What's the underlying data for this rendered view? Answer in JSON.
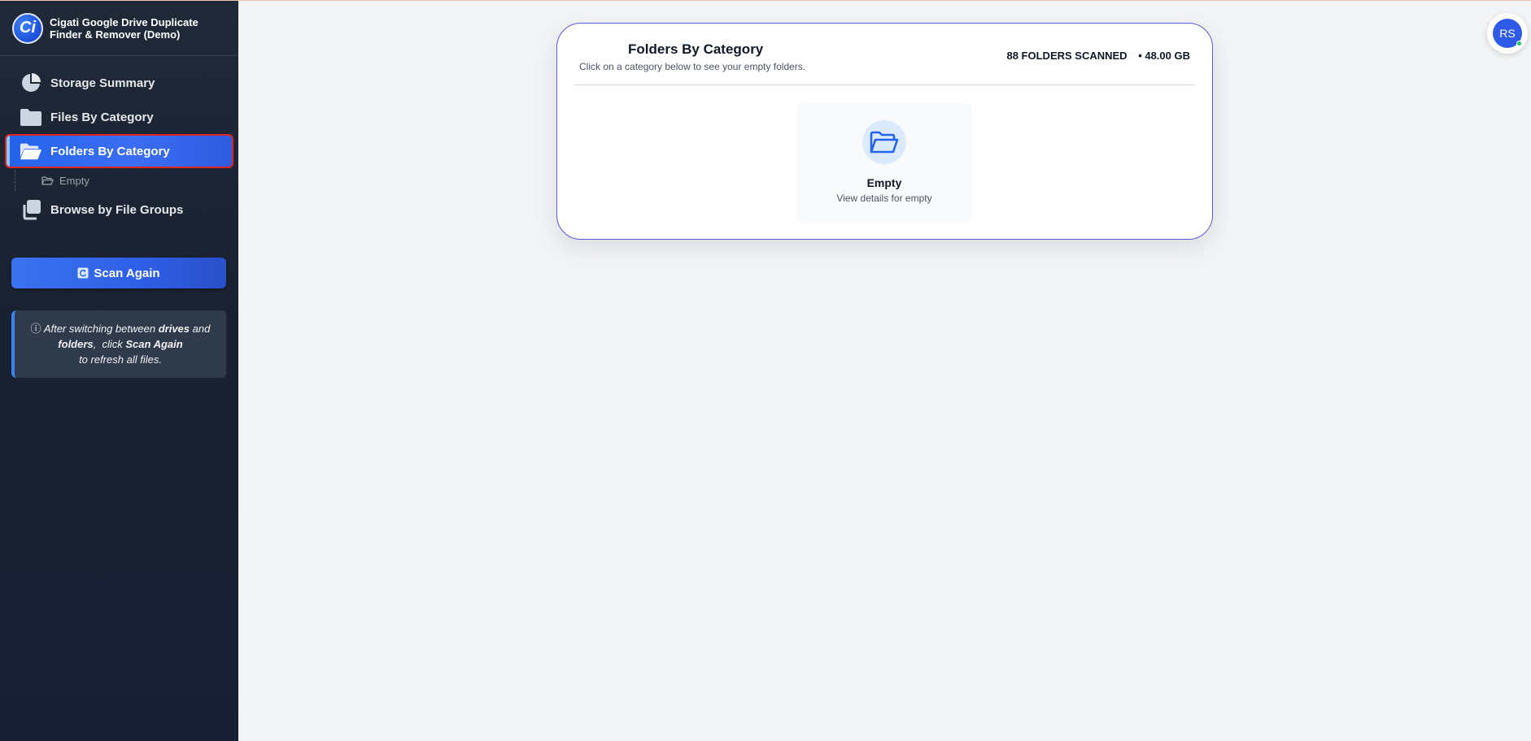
{
  "app": {
    "title": "Cigati Google Drive Duplicate Finder & Remover (Demo)",
    "logo_letter": "Ci"
  },
  "sidebar": {
    "items": [
      {
        "label": "Storage Summary",
        "icon": "pie-chart-icon"
      },
      {
        "label": "Files By Category",
        "icon": "folder-icon"
      },
      {
        "label": "Folders By Category",
        "icon": "folder-open-icon",
        "active": true
      },
      {
        "label": "Browse by File Groups",
        "icon": "copy-icon"
      }
    ],
    "sub_items": [
      {
        "label": "Empty",
        "icon": "folder-open-outline-icon"
      }
    ],
    "scan_button": {
      "label": "Scan Again",
      "icon": "refresh-icon"
    },
    "note": {
      "part1": "After switching between ",
      "drives": "drives",
      "part2": " and",
      "folders": "folders",
      "part3": ",  click ",
      "scan_again": "Scan Again",
      "part4": "to refresh all files."
    }
  },
  "main": {
    "card": {
      "title": "Folders By Category",
      "subtitle": "Click on a category below to see your empty folders.",
      "folders_scanned": "88 FOLDERS SCANNED",
      "size": "• 48.00 GB",
      "categories": [
        {
          "name": "Empty",
          "description": "View details for empty",
          "icon": "folder-open-icon"
        }
      ]
    }
  },
  "user": {
    "initials": "RS",
    "status": "online"
  },
  "colors": {
    "sidebar_bg": "#1f2937",
    "accent": "#2563eb",
    "card_border": "#5b5bd6",
    "highlight_outline": "#dc2626",
    "online": "#22c55e"
  }
}
